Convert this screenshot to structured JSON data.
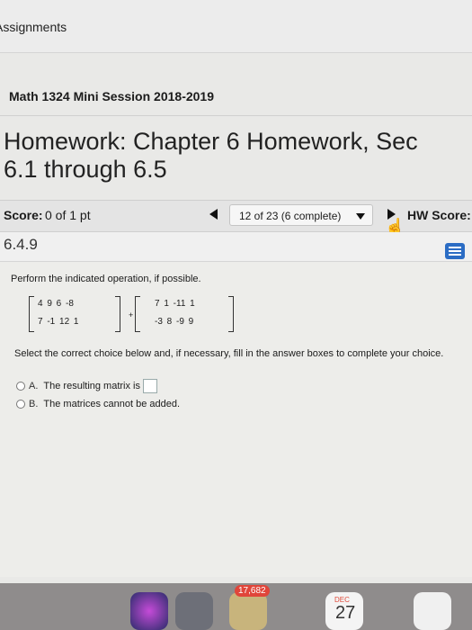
{
  "header": {
    "assignments_label": "Assignments"
  },
  "course": "Math 1324 Mini Session 2018-2019",
  "homework_title": "Homework: Chapter 6 Homework, Sec\n6.1 through 6.5",
  "score": {
    "label": "Score:",
    "value": "0 of 1 pt"
  },
  "question_selector": {
    "value": "12 of 23 (6 complete)"
  },
  "hw_score_label": "HW Score:",
  "question_number": "6.4.9",
  "problem": {
    "prompt": "Perform the indicated operation, if possible.",
    "matrix_a": {
      "row1": "4  9  6  -8",
      "row2": "7  -1  12  1"
    },
    "operator": "+",
    "matrix_b": {
      "row1": "7  1  -11  1",
      "row2": "-3  8  -9  9"
    },
    "instruction": "Select the correct choice below and, if necessary, fill in the answer boxes to complete your choice.",
    "choices": [
      {
        "letter": "A.",
        "text": "The resulting matrix is"
      },
      {
        "letter": "B.",
        "text": "The matrices cannot be added."
      }
    ]
  },
  "dock": {
    "badge_count": "17,682",
    "calendar_month": "DEC",
    "calendar_day": "27"
  },
  "colors": {
    "menu_button": "#2b6cc4",
    "badge": "#e0453a"
  }
}
